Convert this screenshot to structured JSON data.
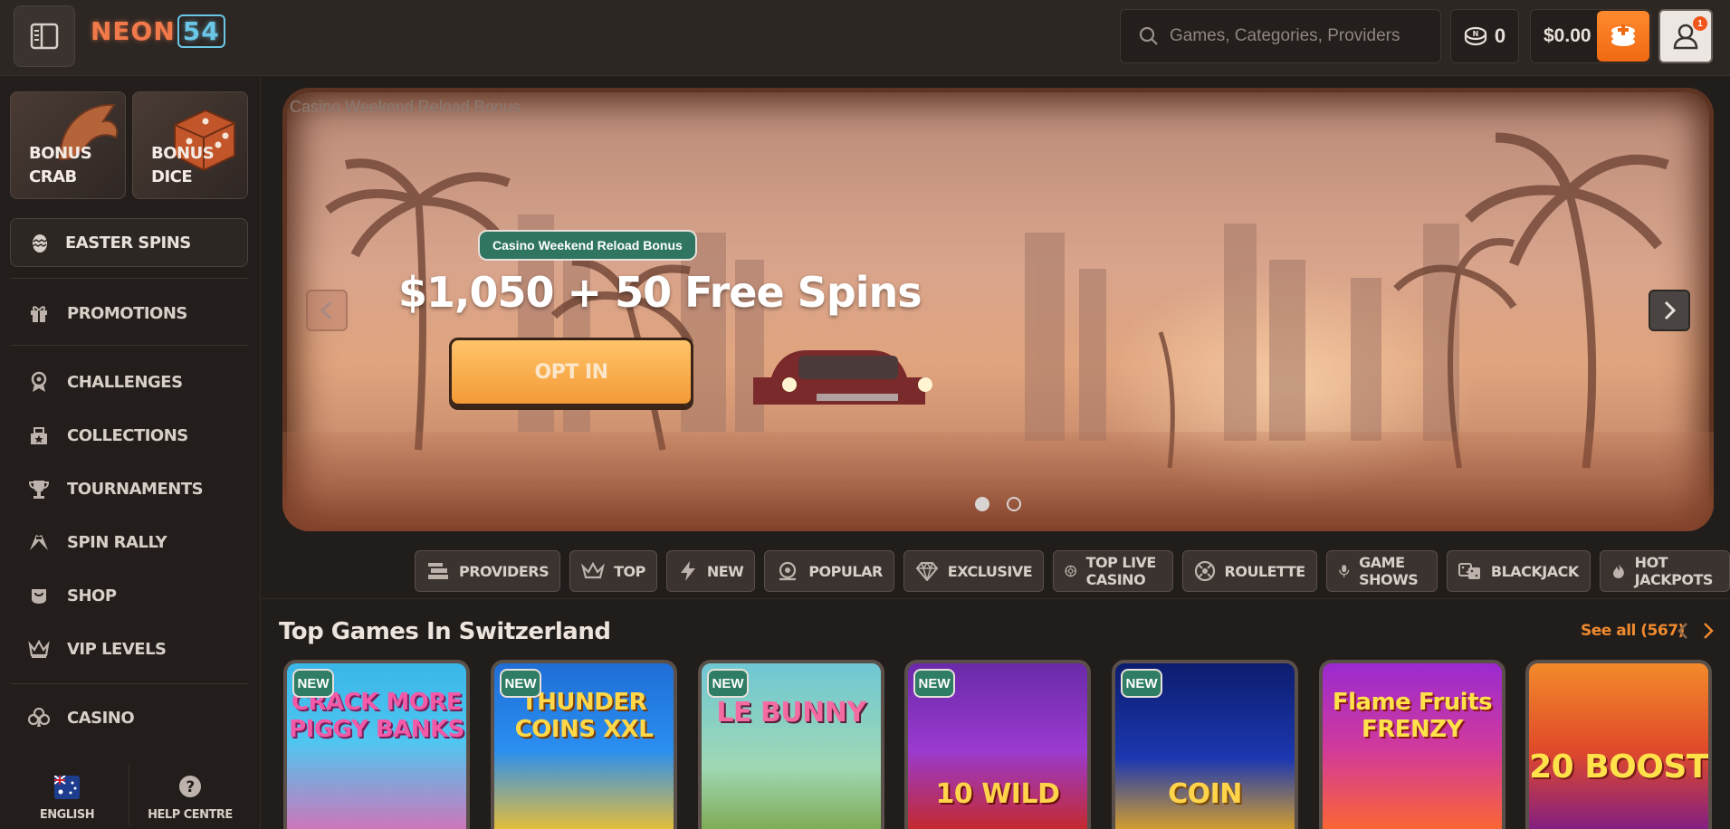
{
  "header": {
    "logo_text": "NEON",
    "logo_num": "54",
    "search_placeholder": "Games, Categories, Providers",
    "coins": "0",
    "balance": "$0.00",
    "notifications": "1"
  },
  "sidebar": {
    "bonus_cards": [
      {
        "line1": "BONUS",
        "line2": "CRAB"
      },
      {
        "line1": "BONUS",
        "line2": "DICE"
      }
    ],
    "easter": "EASTER SPINS",
    "promotions": "PROMOTIONS",
    "items": [
      "CHALLENGES",
      "COLLECTIONS",
      "TOURNAMENTS",
      "SPIN RALLY",
      "SHOP",
      "VIP LEVELS"
    ],
    "casino": "CASINO",
    "language": "ENGLISH",
    "help": "HELP CENTRE"
  },
  "banner": {
    "caption": "Casino Weekend Reload Bonus",
    "pill": "Casino Weekend Reload Bonus",
    "title": "$1,050 + 50 Free Spins",
    "cta": "OPT IN"
  },
  "chips": [
    "PROVIDERS",
    "TOP",
    "NEW",
    "POPULAR",
    "EXCLUSIVE",
    "TOP LIVE CASINO",
    "ROULETTE",
    "GAME SHOWS",
    "BLACKJACK",
    "HOT JACKPOTS"
  ],
  "section": {
    "title": "Top Games In Switzerland",
    "see_all": "See all (567)"
  },
  "games": [
    {
      "title": "CRACK MORE PIGGY BANKS",
      "badge": "NEW"
    },
    {
      "title": "THUNDER COINS XXL",
      "badge": "NEW"
    },
    {
      "title": "LE BUNNY",
      "badge": "NEW"
    },
    {
      "title": "10 WILD",
      "badge": "NEW"
    },
    {
      "title": "COIN",
      "badge": "NEW"
    },
    {
      "title": "Flame Fruits FRENZY",
      "badge": ""
    },
    {
      "title": "20 BOOST",
      "badge": ""
    }
  ],
  "colors": {
    "accent": "#f06a12",
    "new_badge": "#2e7d64",
    "see_all": "#f08a2e"
  }
}
